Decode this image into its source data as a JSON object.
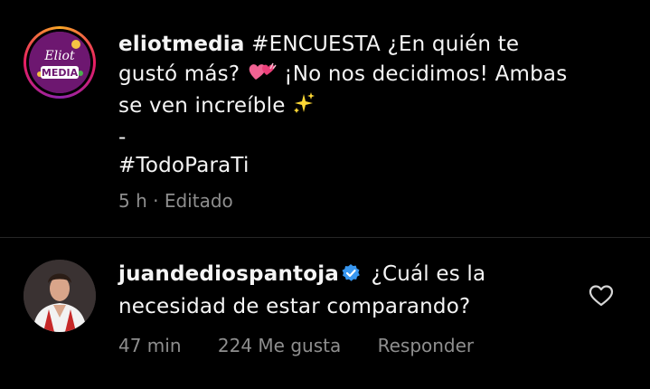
{
  "caption": {
    "username": "eliotmedia",
    "text_line1": "#ENCUESTA ¿En quién te",
    "text_line2a": "gustó más?",
    "text_line2b": "¡No nos decidimos! Ambas",
    "text_line3": "se ven increíble",
    "separator": "-",
    "hashtag": "#TodoParaTi",
    "time": "5 h",
    "edited": "· Editado",
    "logo_text_top": "Eliot",
    "logo_text_bottom": "MEDIA"
  },
  "comment": {
    "username": "juandediospantoja",
    "text_line1": "¿Cuál es la",
    "text_line2": "necesidad de estar comparando?",
    "time": "47 min",
    "likes": "224 Me gusta",
    "reply_label": "Responder"
  },
  "icons": {
    "hearts": "two-hearts-emoji-icon",
    "sparkles": "sparkles-emoji-icon",
    "verified": "verified-badge-icon",
    "like": "heart-outline-icon"
  },
  "colors": {
    "background": "#000000",
    "text": "#f5f5f5",
    "muted": "#8e8e8e",
    "verified": "#3897f0"
  }
}
